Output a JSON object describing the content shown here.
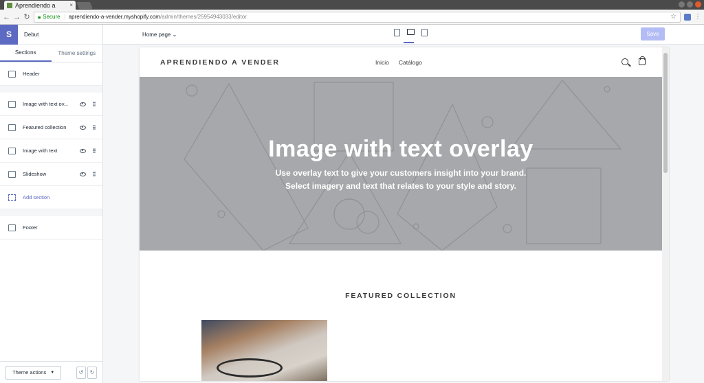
{
  "browser": {
    "tab_title": "Aprendiendo a",
    "tab_close": "×",
    "secure_label": "Secure",
    "url_domain": "aprendiendo-a-vender.myshopify.com",
    "url_path": "/admin/themes/25954943033/editor"
  },
  "sidebar": {
    "logo": "S",
    "theme_name": "Debut",
    "tabs": [
      "Sections",
      "Theme settings"
    ],
    "sections": [
      {
        "label": "Header"
      },
      {
        "label": "Image with text ov..."
      },
      {
        "label": "Featured collection"
      },
      {
        "label": "Image with text"
      },
      {
        "label": "Slideshow"
      },
      {
        "label": "Add section"
      },
      {
        "label": "Footer"
      }
    ],
    "theme_actions": "Theme actions",
    "undo": "↺",
    "redo": "↻"
  },
  "topbar": {
    "page_select": "Home page",
    "save": "Save"
  },
  "store": {
    "logo": "APRENDIENDO A VENDER",
    "nav": [
      "Inicio",
      "Catálogo"
    ],
    "hero_title": "Image with text overlay",
    "hero_line1": "Use overlay text to give your customers insight into your brand.",
    "hero_line2": "Select imagery and text that relates to your style and story.",
    "featured_title": "FEATURED COLLECTION"
  }
}
